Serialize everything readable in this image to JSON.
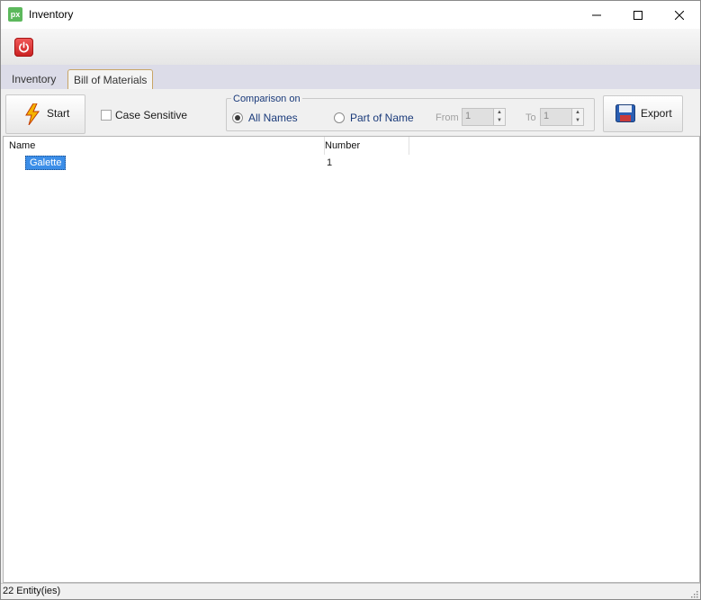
{
  "window": {
    "title": "Inventory",
    "app_icon_text": "px"
  },
  "tabs": [
    {
      "label": "Inventory",
      "active": false
    },
    {
      "label": "Bill of Materials",
      "active": true
    }
  ],
  "options": {
    "start_label": "Start",
    "case_sensitive_label": "Case Sensitive",
    "case_sensitive_checked": false,
    "comparison_title": "Comparison on",
    "radio_all_names": "All Names",
    "radio_part_of_name": "Part of Name",
    "selected_radio": "All Names",
    "from_label": "From",
    "from_value": "1",
    "to_label": "To",
    "to_value": "1",
    "export_label": "Export"
  },
  "list": {
    "columns": [
      "Name",
      "Number"
    ],
    "rows": [
      {
        "name": "Galette",
        "number": "1"
      }
    ]
  },
  "status": {
    "text": "22 Entity(ies)"
  },
  "colors": {
    "selection": "#3c8ee8",
    "tabstrip": "#dcdce8",
    "accent_group": "#1a3a7a"
  }
}
